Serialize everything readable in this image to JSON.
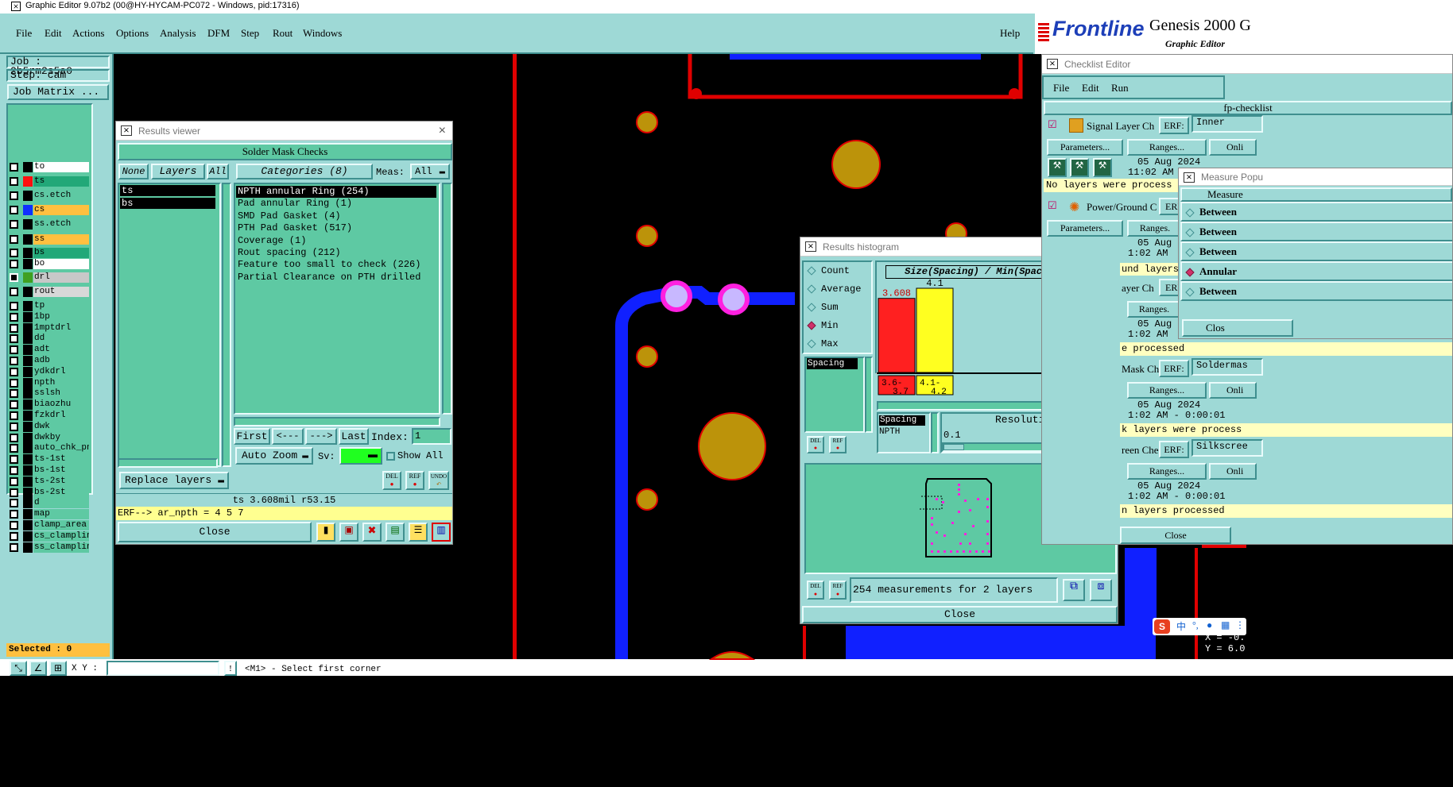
{
  "app": {
    "title": "Graphic Editor 9.07b2 (00@HY-HYCAM-PC072 - Windows, pid:17316)"
  },
  "menu": {
    "items": [
      "File",
      "Edit",
      "Actions",
      "Options",
      "Analysis",
      "DFM",
      "Step",
      "Rout",
      "Windows"
    ],
    "help": "Help"
  },
  "brand": {
    "logo": "Frontline",
    "product": "Genesis 2000 G",
    "subtitle": "Graphic Editor"
  },
  "job": {
    "job_label": "Job : 2b5rm2s5a0",
    "step_label": "Step: cam",
    "matrix_button": "Job Matrix ..."
  },
  "layers": [
    {
      "name": "to",
      "color": "#000000",
      "bg": "#ffffff"
    },
    {
      "name": "ts",
      "color": "#ff1010",
      "bg": "#22a878"
    },
    {
      "name": "cs.etch",
      "color": "#000000",
      "bg": "#5ec9a3"
    },
    {
      "name": "cs",
      "color": "#1030ff",
      "bg": "#ffc040"
    },
    {
      "name": "ss.etch",
      "color": "#000000",
      "bg": "#5ec9a3"
    },
    {
      "name": "ss",
      "color": "#000000",
      "bg": "#ffc040"
    },
    {
      "name": "bs",
      "color": "#000000",
      "bg": "#22a878"
    },
    {
      "name": "bo",
      "color": "#000000",
      "bg": "#ffffff"
    },
    {
      "name": "drl",
      "color": "#40a020",
      "bg": "#c8c8c8"
    },
    {
      "name": "rout",
      "color": "#000000",
      "bg": "#d8d8d8"
    },
    {
      "name": "tp",
      "color": "#000000",
      "bg": "#5ec9a3"
    },
    {
      "name": "1bp",
      "color": "#000000",
      "bg": "#5ec9a3"
    },
    {
      "name": "1mptdrl",
      "color": "#000000",
      "bg": "#5ec9a3"
    },
    {
      "name": "dd",
      "color": "#000000",
      "bg": "#5ec9a3"
    },
    {
      "name": "adt",
      "color": "#000000",
      "bg": "#5ec9a3"
    },
    {
      "name": "adb",
      "color": "#000000",
      "bg": "#5ec9a3"
    },
    {
      "name": "ydkdrl",
      "color": "#000000",
      "bg": "#5ec9a3"
    },
    {
      "name": "npth",
      "color": "#000000",
      "bg": "#5ec9a3"
    },
    {
      "name": "sslsh",
      "color": "#000000",
      "bg": "#5ec9a3"
    },
    {
      "name": "biaozhu",
      "color": "#000000",
      "bg": "#5ec9a3"
    },
    {
      "name": "fzkdrl",
      "color": "#000000",
      "bg": "#5ec9a3"
    },
    {
      "name": "dwk",
      "color": "#000000",
      "bg": "#5ec9a3"
    },
    {
      "name": "dwkby",
      "color": "#000000",
      "bg": "#5ec9a3"
    },
    {
      "name": "auto_chk_pnl",
      "color": "#000000",
      "bg": "#5ec9a3"
    },
    {
      "name": "ts-1st",
      "color": "#000000",
      "bg": "#5ec9a3"
    },
    {
      "name": "bs-1st",
      "color": "#000000",
      "bg": "#5ec9a3"
    },
    {
      "name": "ts-2st",
      "color": "#000000",
      "bg": "#5ec9a3"
    },
    {
      "name": "bs-2st",
      "color": "#000000",
      "bg": "#5ec9a3"
    },
    {
      "name": "d",
      "color": "#000000",
      "bg": "#5ec9a3"
    },
    {
      "name": "map",
      "color": "#000000",
      "bg": "#5ec9a3"
    },
    {
      "name": "clamp_area",
      "color": "#000000",
      "bg": "#5ec9a3"
    },
    {
      "name": "cs_clampline",
      "color": "#000000",
      "bg": "#5ec9a3"
    },
    {
      "name": "ss_clampline",
      "color": "#000000",
      "bg": "#5ec9a3"
    }
  ],
  "selected_label": "Selected : 0",
  "statusbar": {
    "xy_label": "X Y :",
    "prompt": "<M1> - Select first corner"
  },
  "results_viewer": {
    "title": "Results viewer",
    "header": "Solder Mask Checks",
    "none_btn": "None",
    "layers_btn": "Layers",
    "all_btn": "All",
    "categories_btn": "Categories (8)",
    "meas_label": "Meas:",
    "meas_value": "All",
    "layer_list": [
      "ts",
      "bs"
    ],
    "categories": [
      "NPTH annular Ring (254)",
      "Pad annular Ring (1)",
      "SMD Pad Gasket (4)",
      "PTH Pad Gasket (517)",
      "Coverage (1)",
      "Rout spacing (212)",
      "Feature too small to check (226)",
      "Partial Clearance on PTH drilled"
    ],
    "first": "First",
    "prev": "<---",
    "next": "--->",
    "last": "Last",
    "index_label": "Index:",
    "index_value": "1",
    "auto_zoom": "Auto Zoom",
    "sv_label": "Sv:",
    "show_all": "Show All",
    "replace_layers": "Replace layers",
    "del": "DEL",
    "ref": "REF",
    "undo": "UNDO",
    "status": "ts 3.608mil   r53.15",
    "erf": "ERF--> ar_npth = 4 5 7",
    "close": "Close"
  },
  "histogram": {
    "title": "Results histogram",
    "options": [
      {
        "label": "Count",
        "on": false
      },
      {
        "label": "Average",
        "on": false
      },
      {
        "label": "Sum",
        "on": false
      },
      {
        "label": "Min",
        "on": true
      },
      {
        "label": "Max",
        "on": false
      }
    ],
    "list": [
      "Spacing"
    ],
    "chart_title": "Size(Spacing) / Min(Spacing)",
    "bars": [
      {
        "value": 3.608,
        "label": "3.608",
        "color": "#ff2020",
        "range": "3.6-3.7"
      },
      {
        "value": 4.1,
        "label": "4.1",
        "color": "#ffff20",
        "range": "4.1-4.2"
      }
    ],
    "spacing_list": [
      "Spacing",
      "NPTH"
    ],
    "resolution_label": "Resolution",
    "resolution_value": "0.1",
    "summary": "254 measurements for 2 layers",
    "del": "DEL",
    "ref": "REF",
    "close": "Close"
  },
  "checklist": {
    "title": "Checklist Editor",
    "menu": [
      "File",
      "Edit",
      "Run"
    ],
    "name": "fp-checklist",
    "rows": [
      {
        "name": "Signal Layer Ch",
        "erf_label": "ERF:",
        "erf": "Inner",
        "params": "Parameters...",
        "ranges": "Ranges...",
        "onli": "Onli",
        "date": "05 Aug 2024",
        "time": "11:02 AM - ",
        "msg": "No layers were process"
      },
      {
        "name": "Power/Ground C",
        "erf_label": "ERF",
        "params": "Parameters...",
        "ranges": "Ranges.",
        "date": "05 Aug",
        "time": "1:02 AM",
        "msg": "und layers"
      },
      {
        "name": "ayer Ch",
        "erf_label": "ERF",
        "ranges": "Ranges.",
        "date": "05 Aug",
        "time": "1:02 AM",
        "msg": "e processed"
      },
      {
        "name": "Mask Ch",
        "erf_label": "ERF:",
        "erf": "Soldermas",
        "ranges": "Ranges...",
        "onli": "Onli",
        "date": "05 Aug 2024",
        "time": "1:02 AM - 0:00:01",
        "msg": "k layers were process"
      },
      {
        "name": "reen Che",
        "erf_label": "ERF:",
        "erf": "Silkscree",
        "ranges": "Ranges...",
        "onli": "Onli",
        "date": "05 Aug 2024",
        "time": "1:02 AM - 0:00:01",
        "msg": "n layers processed"
      }
    ],
    "close": "Close"
  },
  "measure": {
    "title": "Measure Popu",
    "header": "Measure",
    "items": [
      {
        "label": "Between",
        "on": false
      },
      {
        "label": "Between",
        "on": false
      },
      {
        "label": "Between",
        "on": false
      },
      {
        "label": "Annular",
        "on": true
      },
      {
        "label": "Between",
        "on": false
      }
    ],
    "close": "Clos"
  },
  "coords": {
    "x": "X = -0.",
    "y": "Y = 6.0"
  },
  "ime": {
    "label": "中"
  }
}
